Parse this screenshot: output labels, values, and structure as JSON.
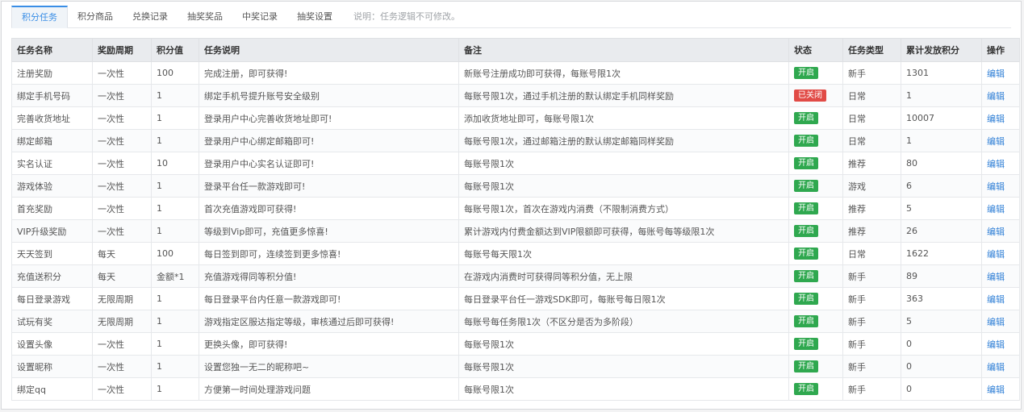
{
  "tabs": [
    {
      "label": "积分任务",
      "active": true
    },
    {
      "label": "积分商品",
      "active": false
    },
    {
      "label": "兑换记录",
      "active": false
    },
    {
      "label": "抽奖奖品",
      "active": false
    },
    {
      "label": "中奖记录",
      "active": false
    },
    {
      "label": "抽奖设置",
      "active": false
    }
  ],
  "note": "说明：任务逻辑不可修改。",
  "columns": [
    "任务名称",
    "奖励周期",
    "积分值",
    "任务说明",
    "备注",
    "状态",
    "任务类型",
    "累计发放积分",
    "操作"
  ],
  "status_colors": {
    "on": "#2fa84f",
    "off": "#e14b46"
  },
  "edit_label": "编辑",
  "rows": [
    {
      "name": "注册奖励",
      "period": "一次性",
      "points": "100",
      "desc": "完成注册，即可获得!",
      "remark": "新账号注册成功即可获得，每账号限1次",
      "status": "开启",
      "status_on": true,
      "type": "新手",
      "total": "1301"
    },
    {
      "name": "绑定手机号码",
      "period": "一次性",
      "points": "1",
      "desc": "绑定手机号提升账号安全级别",
      "remark": "每账号限1次，通过手机注册的默认绑定手机同样奖励",
      "status": "已关闭",
      "status_on": false,
      "type": "日常",
      "total": "1"
    },
    {
      "name": "完善收货地址",
      "period": "一次性",
      "points": "1",
      "desc": "登录用户中心完善收货地址即可!",
      "remark": "添加收货地址即可，每账号限1次",
      "status": "开启",
      "status_on": true,
      "type": "日常",
      "total": "10007"
    },
    {
      "name": "绑定邮箱",
      "period": "一次性",
      "points": "1",
      "desc": "登录用户中心绑定邮箱即可!",
      "remark": "每账号限1次，通过邮箱注册的默认绑定邮箱同样奖励",
      "status": "开启",
      "status_on": true,
      "type": "日常",
      "total": "1"
    },
    {
      "name": "实名认证",
      "period": "一次性",
      "points": "10",
      "desc": "登录用户中心实名认证即可!",
      "remark": "每账号限1次",
      "status": "开启",
      "status_on": true,
      "type": "推荐",
      "total": "80"
    },
    {
      "name": "游戏体验",
      "period": "一次性",
      "points": "1",
      "desc": "登录平台任一款游戏即可!",
      "remark": "每账号限1次",
      "status": "开启",
      "status_on": true,
      "type": "游戏",
      "total": "6"
    },
    {
      "name": "首充奖励",
      "period": "一次性",
      "points": "1",
      "desc": "首次充值游戏即可获得!",
      "remark": "每账号限1次，首次在游戏内消费（不限制消费方式）",
      "status": "开启",
      "status_on": true,
      "type": "推荐",
      "total": "5"
    },
    {
      "name": "VIP升级奖励",
      "period": "一次性",
      "points": "1",
      "desc": "等级到Vip即可，充值更多惊喜!",
      "remark": "累计游戏内付费金额达到VIP限额即可获得，每账号每等级限1次",
      "status": "开启",
      "status_on": true,
      "type": "推荐",
      "total": "26"
    },
    {
      "name": "天天签到",
      "period": "每天",
      "points": "100",
      "desc": "每日签到即可，连续签到更多惊喜!",
      "remark": "每账号每天限1次",
      "status": "开启",
      "status_on": true,
      "type": "日常",
      "total": "1622"
    },
    {
      "name": "充值送积分",
      "period": "每天",
      "points": "金额*1",
      "desc": "充值游戏得同等积分值!",
      "remark": "在游戏内消费时可获得同等积分值，无上限",
      "status": "开启",
      "status_on": true,
      "type": "新手",
      "total": "89"
    },
    {
      "name": "每日登录游戏",
      "period": "无限周期",
      "points": "1",
      "desc": "每日登录平台内任意一款游戏即可!",
      "remark": "每日登录平台任一游戏SDK即可，每账号每日限1次",
      "status": "开启",
      "status_on": true,
      "type": "新手",
      "total": "363"
    },
    {
      "name": "试玩有奖",
      "period": "无限周期",
      "points": "1",
      "desc": "游戏指定区服达指定等级，审核通过后即可获得!",
      "remark": "每账号每任务限1次（不区分是否为多阶段）",
      "status": "开启",
      "status_on": true,
      "type": "新手",
      "total": "5"
    },
    {
      "name": "设置头像",
      "period": "一次性",
      "points": "1",
      "desc": "更换头像，即可获得!",
      "remark": "每账号限1次",
      "status": "开启",
      "status_on": true,
      "type": "新手",
      "total": "0"
    },
    {
      "name": "设置昵称",
      "period": "一次性",
      "points": "1",
      "desc": "设置您独一无二的昵称吧~",
      "remark": "每账号限1次",
      "status": "开启",
      "status_on": true,
      "type": "新手",
      "total": "0"
    },
    {
      "name": "绑定qq",
      "period": "一次性",
      "points": "1",
      "desc": "方便第一时间处理游戏问题",
      "remark": "每账号限1次",
      "status": "开启",
      "status_on": true,
      "type": "新手",
      "total": "0"
    }
  ]
}
